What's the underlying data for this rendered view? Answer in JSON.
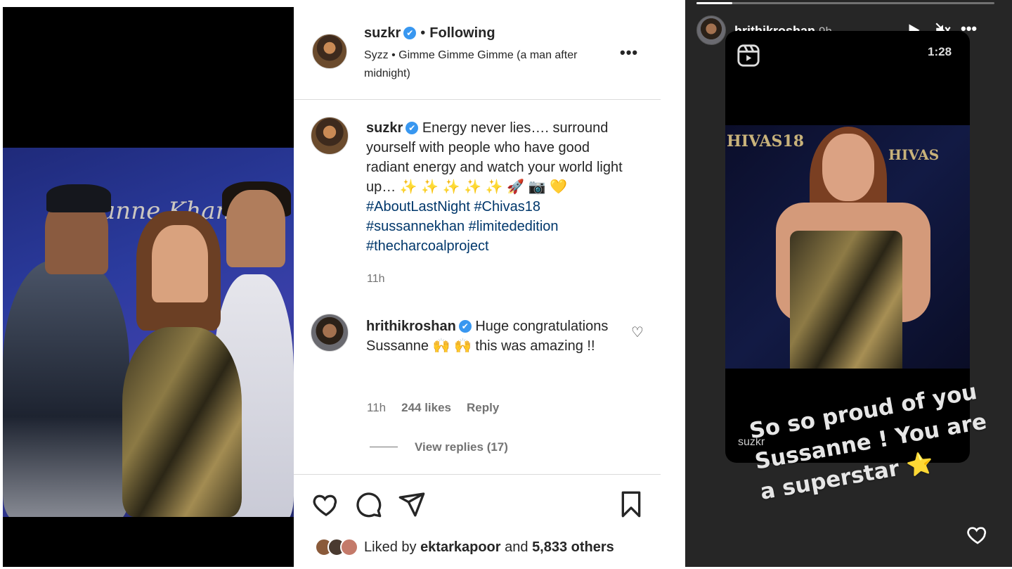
{
  "post": {
    "header": {
      "username": "suzkr",
      "verified_mark": "✔",
      "separator": "•",
      "follow_status": "Following",
      "audio": "Syzz • Gimme Gimme Gimme (a man after midnight)",
      "more": "•••"
    },
    "caption": {
      "username": "suzkr",
      "text": "Energy never lies…. surround yourself with people who have good radiant energy and watch your world light up… ✨ ✨ ✨ ✨ ✨ 🚀 📷 💛",
      "hashtags": "#AboutLastNight #Chivas18 #sussannekhan #limitededition #thecharcoalproject",
      "time": "11h"
    },
    "comment": {
      "username": "hrithikroshan",
      "text": "Huge congratulations Sussanne 🙌 🙌 this was amazing !!",
      "time": "11h",
      "likes": "244 likes",
      "reply": "Reply",
      "view_replies": "View replies (17)",
      "heart_icon": "♡"
    },
    "photo": {
      "banner": "anne Khan"
    },
    "liked_by": {
      "prefix": "Liked by",
      "user": "ektarkapoor",
      "and": "and",
      "others": "5,833 others"
    },
    "icons": [
      "heart-icon",
      "comment-icon",
      "share-icon",
      "bookmark-icon"
    ]
  },
  "story": {
    "username": "hrithikroshan",
    "time": "9h",
    "more": "•••",
    "progress": 0.12,
    "reel": {
      "duration": "1:28",
      "credit": "suzkr",
      "brand_left": "HIVAS18",
      "brand_right": "HIVAS"
    },
    "overlay_text": "So so proud of you Sussanne ! You are a superstar ⭐"
  },
  "colors": {
    "link": "#00376b",
    "verified": "#3897f0",
    "muted": "#737373",
    "story_bg": "#262626"
  }
}
